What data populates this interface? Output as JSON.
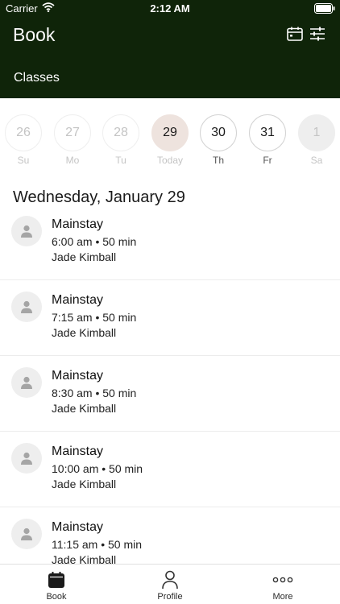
{
  "status_bar": {
    "carrier": "Carrier",
    "time": "2:12 AM"
  },
  "header": {
    "title": "Book",
    "subtitle": "Classes",
    "background_color": "#0f2409"
  },
  "calendar_strip": {
    "days": [
      {
        "number": "26",
        "label": "Su",
        "state": "past"
      },
      {
        "number": "27",
        "label": "Mo",
        "state": "past"
      },
      {
        "number": "28",
        "label": "Tu",
        "state": "past"
      },
      {
        "number": "29",
        "label": "Today",
        "state": "selected"
      },
      {
        "number": "30",
        "label": "Th",
        "state": "available"
      },
      {
        "number": "31",
        "label": "Fr",
        "state": "available"
      },
      {
        "number": "1",
        "label": "Sa",
        "state": "disabled"
      }
    ]
  },
  "schedule": {
    "date_heading": "Wednesday, January 29",
    "classes": [
      {
        "name": "Mainstay",
        "time": "6:00 am • 50 min",
        "instructor": "Jade Kimball"
      },
      {
        "name": "Mainstay",
        "time": "7:15 am • 50 min",
        "instructor": "Jade Kimball"
      },
      {
        "name": "Mainstay",
        "time": "8:30 am • 50 min",
        "instructor": "Jade Kimball"
      },
      {
        "name": "Mainstay",
        "time": "10:00 am • 50 min",
        "instructor": "Jade Kimball"
      },
      {
        "name": "Mainstay",
        "time": "11:15 am • 50 min",
        "instructor": "Jade Kimball"
      }
    ]
  },
  "tab_bar": {
    "tabs": [
      {
        "label": "Book",
        "icon": "calendar-icon"
      },
      {
        "label": "Profile",
        "icon": "person-icon"
      },
      {
        "label": "More",
        "icon": "more-icon"
      }
    ]
  }
}
